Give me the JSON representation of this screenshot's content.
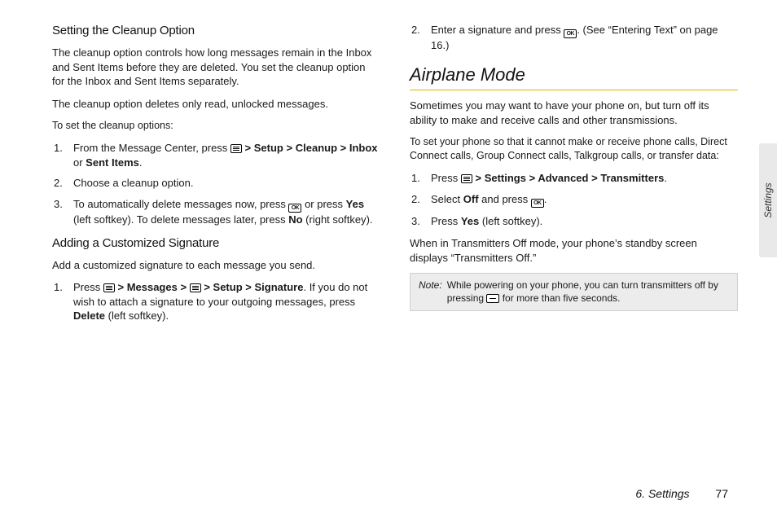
{
  "sideTab": "Settings",
  "footer": {
    "chapter": "6. Settings",
    "page": "77"
  },
  "left": {
    "h1": "Setting the Cleanup Option",
    "p1": "The cleanup option controls how long messages remain in the Inbox and Sent Items before they are deleted. You set the cleanup option for the Inbox and Sent Items separately.",
    "p2": "The cleanup option deletes only read, unlocked messages.",
    "p3": "To set the cleanup options:",
    "s1": {
      "n": "1.",
      "pre": "From the Message Center, press ",
      "setup": "Setup",
      "cleanup": "Cleanup",
      "inbox": "Inbox",
      "or": " or ",
      "sent": "Sent Items",
      "dot": "."
    },
    "s2": {
      "n": "2.",
      "t": "Choose a cleanup option."
    },
    "s3": {
      "n": "3.",
      "pre": "To automatically delete messages now, press ",
      "mid": " or press ",
      "yes": "Yes",
      "a": " (left softkey). To delete messages later, press ",
      "no": "No",
      "b": " (right softkey)."
    },
    "h2": "Adding a Customized Signature",
    "p4": "Add a customized signature to each message you send.",
    "s4": {
      "n": "1.",
      "pre": "Press ",
      "messages": "Messages",
      "setup": "Setup",
      "sig": "Signature",
      "mid": ". If you do not wish to attach a signature to your outgoing messages, press ",
      "del": "Delete",
      "end": " (left softkey)."
    }
  },
  "right": {
    "s0": {
      "n": "2.",
      "pre": "Enter a signature and press ",
      "post": ". (See “Entering Text” on page 16.)"
    },
    "hSection": "Airplane Mode",
    "p1": "Sometimes you may want to have your phone on, but turn off its ability to make and receive calls and other transmissions.",
    "p2": "To set your phone so that it cannot make or receive phone calls, Direct Connect calls, Group Connect calls, Talkgroup calls, or transfer data:",
    "s1": {
      "n": "1.",
      "pre": "Press ",
      "settings": "Settings",
      "advanced": "Advanced",
      "trans": "Transmitters",
      "dot": "."
    },
    "s2": {
      "n": "2.",
      "pre": "Select ",
      "off": "Off",
      "mid": " and press ",
      "dot": "."
    },
    "s3": {
      "n": "3.",
      "pre": "Press ",
      "yes": "Yes",
      "post": " (left softkey)."
    },
    "p3": "When in Transmitters Off mode, your phone’s standby screen displays “Transmitters Off.”",
    "note": {
      "label": "Note:",
      "pre": "While powering on your phone, you can turn transmitters off by pressing ",
      "post": " for more than five seconds."
    }
  }
}
